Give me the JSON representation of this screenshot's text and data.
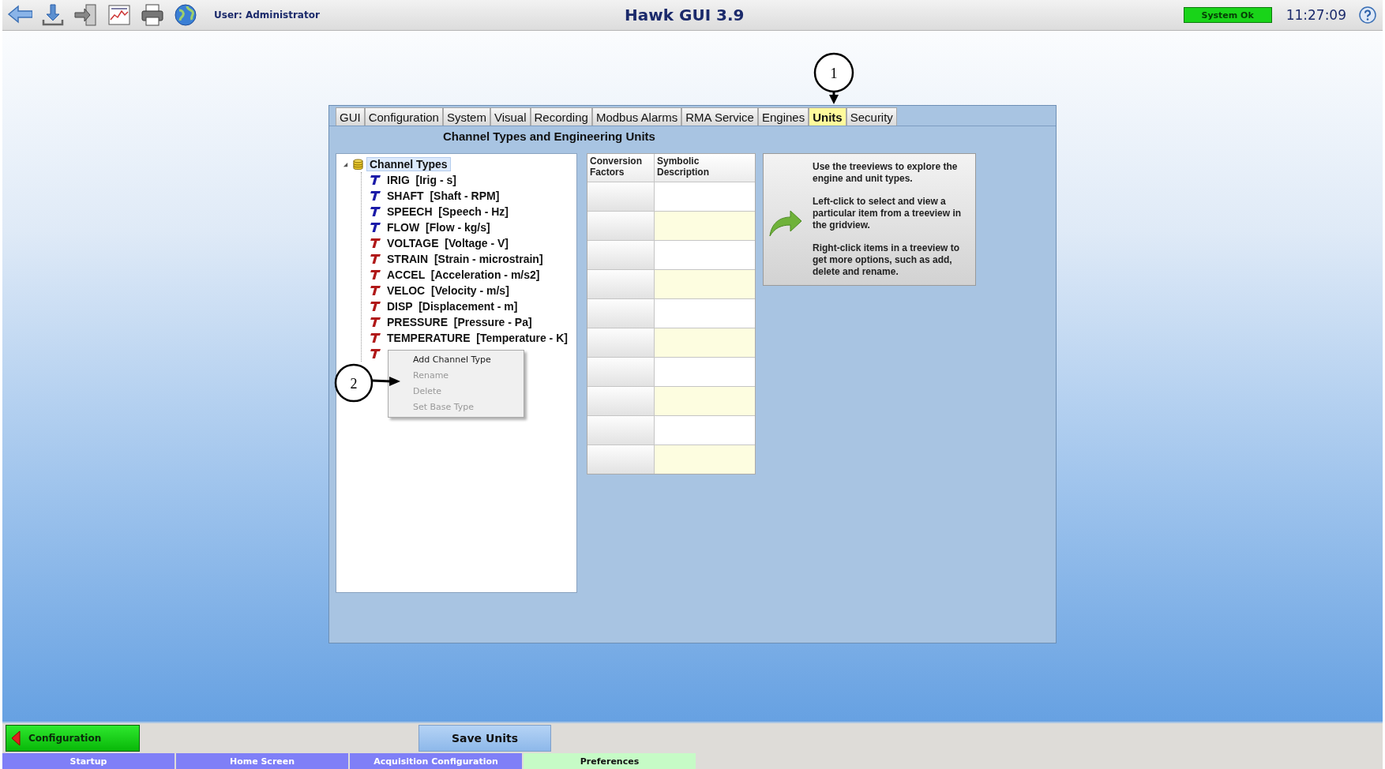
{
  "top_bar": {
    "user": "User: Administrator",
    "title": "Hawk GUI 3.9",
    "status": "System Ok",
    "time": "11:27:09"
  },
  "tabs": [
    {
      "label": "GUI",
      "selected": false
    },
    {
      "label": "Configuration",
      "selected": false
    },
    {
      "label": "System",
      "selected": false
    },
    {
      "label": "Visual",
      "selected": false
    },
    {
      "label": "Recording",
      "selected": false
    },
    {
      "label": "Modbus Alarms",
      "selected": false
    },
    {
      "label": "RMA Service",
      "selected": false
    },
    {
      "label": "Engines",
      "selected": false
    },
    {
      "label": "Units",
      "selected": true
    },
    {
      "label": "Security",
      "selected": false
    }
  ],
  "panel_title": "Channel Types and Engineering Units",
  "tree": {
    "label": "Channel Types",
    "expanded": true,
    "selected": true,
    "children": [
      {
        "label": "IRIG  [Irig - s]",
        "color": "#1a1aa8",
        "selected": false
      },
      {
        "label": "SHAFT  [Shaft - RPM]",
        "color": "#1a1aa8",
        "selected": false
      },
      {
        "label": "SPEECH  [Speech - Hz]",
        "color": "#1a1aa8",
        "selected": false
      },
      {
        "label": "FLOW  [Flow - kg/s]",
        "color": "#1a1aa8",
        "selected": false
      },
      {
        "label": "VOLTAGE  [Voltage - V]",
        "color": "#b01818",
        "selected": false
      },
      {
        "label": "STRAIN  [Strain - microstrain]",
        "color": "#b01818",
        "selected": false
      },
      {
        "label": "ACCEL  [Acceleration - m/s2]",
        "color": "#b01818",
        "selected": false
      },
      {
        "label": "VELOC  [Velocity - m/s]",
        "color": "#b01818",
        "selected": false
      },
      {
        "label": "DISP  [Displacement - m]",
        "color": "#b01818",
        "selected": false
      },
      {
        "label": "PRESSURE  [Pressure - Pa]",
        "color": "#b01818",
        "selected": false
      },
      {
        "label": "TEMPERATURE  [Temperature - K]",
        "color": "#b01818",
        "selected": false
      },
      {
        "color": "#b01818"
      }
    ]
  },
  "context_menu": [
    {
      "label": "Add Channel Type",
      "disabled": false
    },
    {
      "label": "Rename",
      "disabled": true
    },
    {
      "label": "Delete",
      "disabled": true
    },
    {
      "label": "Set Base Type",
      "disabled": true
    }
  ],
  "grid": {
    "columns": [
      "Conversion Factors",
      "Symbolic Description"
    ]
  },
  "help_panel": [
    "Use the treeviews to explore the engine and unit types.",
    "Left-click to select and view a particular item from a treeview in the gridview.",
    "Right-click items in a treeview to get more options, such as add, delete and rename."
  ],
  "callouts": [
    "1",
    "2"
  ],
  "back_button": "Configuration",
  "save_button": "Save Units",
  "nav_tabs": [
    {
      "label": "Startup",
      "selected": false
    },
    {
      "label": "Home Screen",
      "selected": false
    },
    {
      "label": "Acquisition Configuration",
      "selected": false
    },
    {
      "label": "Preferences",
      "selected": true
    }
  ]
}
